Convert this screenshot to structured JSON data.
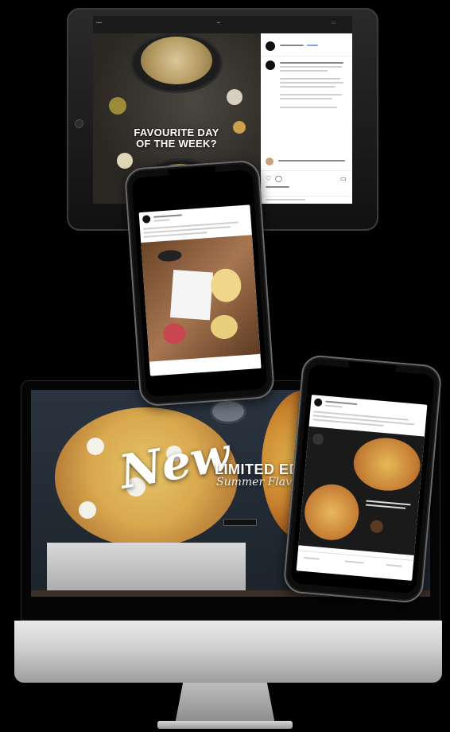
{
  "ipad": {
    "headline_line1": "FAVOURITE DAY",
    "headline_line2": "OF THE WEEK?"
  },
  "imac": {
    "script_word": "New",
    "limited_text": "LIMITED ED",
    "summer_text": "Summer Flav"
  },
  "colors": {
    "background": "#000000",
    "post_card": "#ffffff",
    "imac_chin": "#d4d4d4"
  }
}
